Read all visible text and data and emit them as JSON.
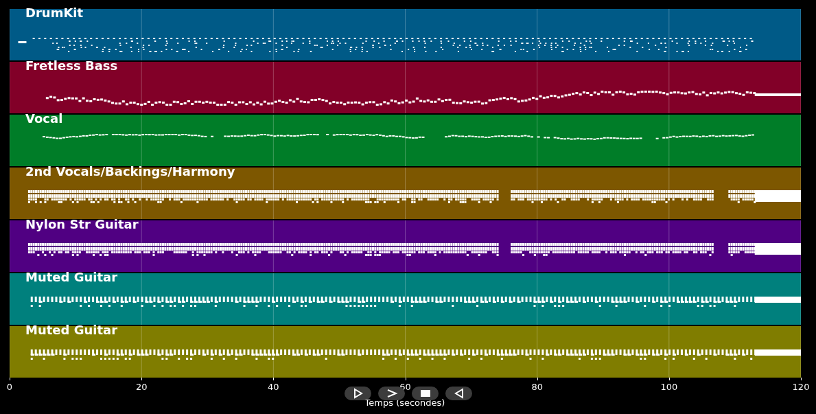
{
  "tracks": [
    {
      "name": "DrumKit",
      "color": "#005a87",
      "kind": "percussion"
    },
    {
      "name": "Fretless Bass",
      "color": "#820028",
      "kind": "line"
    },
    {
      "name": "Vocal",
      "color": "#007d28",
      "kind": "melody"
    },
    {
      "name": "2nd Vocals/Backings/Harmony",
      "color": "#7d5700",
      "kind": "chords"
    },
    {
      "name": "Nylon Str Guitar",
      "color": "#500082",
      "kind": "chords"
    },
    {
      "name": "Muted Guitar",
      "color": "#00807d",
      "kind": "riff"
    },
    {
      "name": "Muted Guitar",
      "color": "#807d00",
      "kind": "riff"
    }
  ],
  "x_axis": {
    "label": "Temps (secondes)",
    "ticks": [
      "0",
      "20",
      "40",
      "60",
      "80",
      "100",
      "120"
    ]
  }
}
